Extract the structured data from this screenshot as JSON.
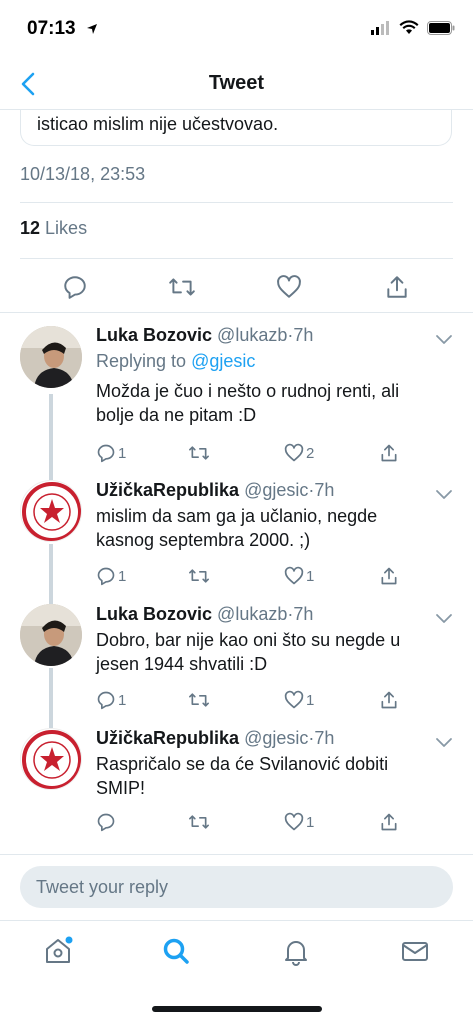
{
  "status_bar": {
    "time": "07:13"
  },
  "nav": {
    "title": "Tweet"
  },
  "tweet": {
    "text_fragment": "isticao mislim nije učestvovao.",
    "date": "10/13/18, 23:53",
    "likes_count": "12",
    "likes_label": "Likes"
  },
  "replies": [
    {
      "name": "Luka Bozovic",
      "handle": "@lukazb",
      "sep": "·",
      "time": "7h",
      "replying_prefix": "Replying to",
      "replying_to": "@gjesic",
      "text": "Možda je čuo i nešto o rudnoj renti, ali bolje da ne pitam :D",
      "reply_count": "1",
      "retweet_count": "",
      "like_count": "2"
    },
    {
      "name": "UžičkaRepublika",
      "handle": "@gjesic",
      "sep": "·",
      "time": "7h",
      "text": "mislim da sam ga ja učlanio, negde kasnog septembra 2000. ;)",
      "reply_count": "1",
      "retweet_count": "",
      "like_count": "1"
    },
    {
      "name": "Luka Bozovic",
      "handle": "@lukazb",
      "sep": "·",
      "time": "7h",
      "text": "Dobro, bar nije kao oni što su negde u jesen 1944 shvatili :D",
      "reply_count": "1",
      "retweet_count": "",
      "like_count": "1"
    },
    {
      "name": "UžičkaRepublika",
      "handle": "@gjesic",
      "sep": "·",
      "time": "7h",
      "text": "Raspričalo se da će Svilanović dobiti SMIP!",
      "reply_count": "",
      "retweet_count": "",
      "like_count": "1"
    }
  ],
  "compose": {
    "placeholder": "Tweet your reply"
  },
  "colors": {
    "accent": "#1da1f2",
    "text": "#14171a",
    "secondary": "#657786",
    "border": "#e1e8ed",
    "like_red": "#e0245e"
  },
  "icons": {
    "actions": [
      "reply-icon",
      "retweet-icon",
      "like-icon",
      "share-icon"
    ],
    "tabs": [
      "home-icon",
      "search-icon",
      "notifications-icon",
      "messages-icon"
    ]
  }
}
